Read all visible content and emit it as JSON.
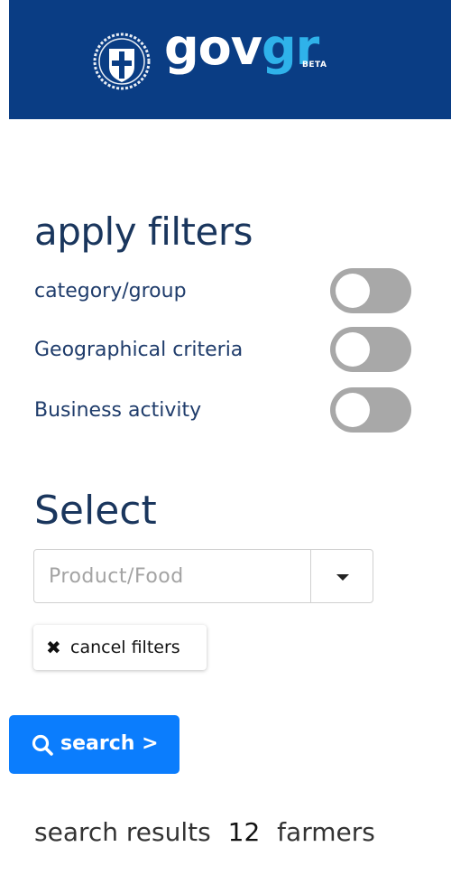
{
  "header": {
    "logo_gov": "gov",
    "logo_gr": "gr",
    "beta_label": "BETA",
    "emblem_icon": "greek-coat-of-arms-icon",
    "background_color": "#0a3d84",
    "accent_color": "#2fb2ea"
  },
  "filters": {
    "title": "apply filters",
    "items": [
      {
        "label": "category/group",
        "enabled": false
      },
      {
        "label": "Geographical criteria",
        "enabled": false
      },
      {
        "label": "Business activity",
        "enabled": false
      }
    ],
    "toggle_off_color": "#a8a8a8"
  },
  "select": {
    "title": "Select",
    "placeholder": "Product/Food",
    "value": "",
    "dropdown_icon": "caret-down-icon"
  },
  "cancel_button": {
    "icon": "close-icon",
    "label": "cancel filters"
  },
  "search_button": {
    "icon": "search-icon",
    "label": "search >",
    "color": "#0b7dfd"
  },
  "results": {
    "prefix": "search results",
    "count": "12",
    "suffix": "farmers"
  }
}
